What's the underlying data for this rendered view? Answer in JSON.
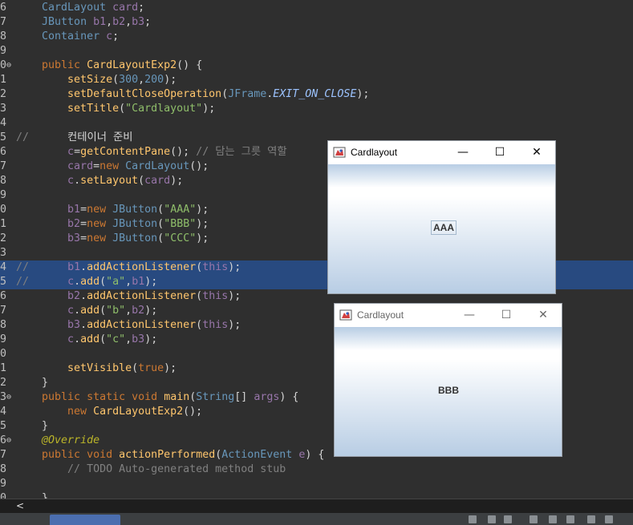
{
  "editor": {
    "lines": [
      {
        "num": "6",
        "text": "    CardLayout card;"
      },
      {
        "num": "7",
        "text": "    JButton b1,b2,b3;"
      },
      {
        "num": "8",
        "text": "    Container c;"
      },
      {
        "num": "9",
        "text": ""
      },
      {
        "num": "0",
        "text": "    public CardLayoutExp2() {"
      },
      {
        "num": "1",
        "text": "        setSize(300,200);"
      },
      {
        "num": "2",
        "text": "        setDefaultCloseOperation(JFrame.EXIT_ON_CLOSE);"
      },
      {
        "num": "3",
        "text": "        setTitle(\"Cardlayout\");"
      },
      {
        "num": "4",
        "text": ""
      },
      {
        "num": "5",
        "text": "//      컨테이너 준비"
      },
      {
        "num": "6",
        "text": "        c=getContentPane(); // 담는 그릇 역할"
      },
      {
        "num": "7",
        "text": "        card=new CardLayout();"
      },
      {
        "num": "8",
        "text": "        c.setLayout(card);"
      },
      {
        "num": "9",
        "text": ""
      },
      {
        "num": "0",
        "text": "        b1=new JButton(\"AAA\");"
      },
      {
        "num": "1",
        "text": "        b2=new JButton(\"BBB\");"
      },
      {
        "num": "2",
        "text": "        b3=new JButton(\"CCC\");"
      },
      {
        "num": "3",
        "text": ""
      },
      {
        "num": "4",
        "text": "//      b1.addActionListener(this);"
      },
      {
        "num": "5",
        "text": "//      c.add(\"a\",b1);"
      },
      {
        "num": "6",
        "text": "        b2.addActionListener(this);"
      },
      {
        "num": "7",
        "text": "        c.add(\"b\",b2);"
      },
      {
        "num": "8",
        "text": "        b3.addActionListener(this);"
      },
      {
        "num": "9",
        "text": "        c.add(\"c\",b3);"
      },
      {
        "num": "0",
        "text": ""
      },
      {
        "num": "1",
        "text": "        setVisible(true);"
      },
      {
        "num": "2",
        "text": "    }"
      },
      {
        "num": "3",
        "text": "    public static void main(String[] args) {"
      },
      {
        "num": "4",
        "text": "        new CardLayoutExp2();"
      },
      {
        "num": "5",
        "text": "    }"
      },
      {
        "num": "6",
        "text": "    @Override"
      },
      {
        "num": "7",
        "text": "    public void actionPerformed(ActionEvent e) {"
      },
      {
        "num": "8",
        "text": "        // TODO Auto-generated method stub"
      },
      {
        "num": "9",
        "text": ""
      },
      {
        "num": "0",
        "text": "    }"
      }
    ],
    "fold_markers_on": [
      "0",
      "3",
      "6"
    ],
    "highlighted_lines": [
      18,
      19
    ]
  },
  "window_front": {
    "title": "Cardlayout",
    "button_label": "AAA",
    "minimize": "—",
    "maximize": "☐",
    "close": "✕"
  },
  "window_back": {
    "title": "Cardlayout",
    "button_label": "BBB",
    "minimize": "—",
    "maximize": "☐",
    "close": "✕"
  },
  "scroll_left_arrow": "<",
  "colors": {
    "editor_bg": "#2f2f2f",
    "selection": "#284a80",
    "keyword": "#cc7832",
    "string": "#8fbe6a",
    "comment": "#808080"
  }
}
